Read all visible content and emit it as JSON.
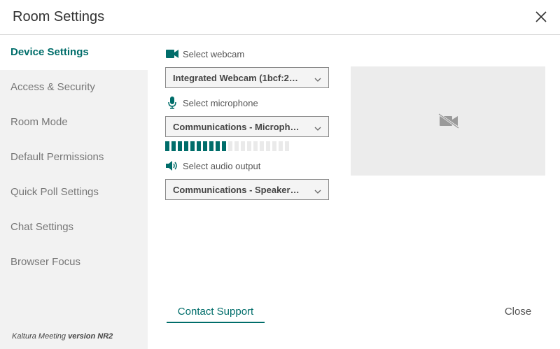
{
  "dialog": {
    "title": "Room Settings"
  },
  "sidebar": {
    "items": [
      {
        "label": "Device Settings"
      },
      {
        "label": "Access & Security"
      },
      {
        "label": "Room Mode"
      },
      {
        "label": "Default Permissions"
      },
      {
        "label": "Quick Poll Settings"
      },
      {
        "label": "Chat Settings"
      },
      {
        "label": "Browser Focus"
      }
    ],
    "active_index": 0,
    "version_prefix": "Kaltura Meeting",
    "version_value": "version NR2"
  },
  "devices": {
    "webcam": {
      "label": "Select webcam",
      "value": "Integrated Webcam (1bcf:2…",
      "icon": "video-camera-icon"
    },
    "microphone": {
      "label": "Select microphone",
      "value": "Communications - Microph…",
      "icon": "microphone-icon"
    },
    "mic_level": {
      "active_segments": 10,
      "total_segments": 20
    },
    "audio_output": {
      "label": "Select audio output",
      "value": "Communications - Speaker…",
      "icon": "speaker-icon"
    }
  },
  "preview": {
    "icon": "camera-off-icon"
  },
  "footer": {
    "contact_label": "Contact Support",
    "close_label": "Close"
  },
  "colors": {
    "accent": "#006d6a",
    "sidebar_bg": "#f2f2f2",
    "preview_bg": "#ececec"
  }
}
